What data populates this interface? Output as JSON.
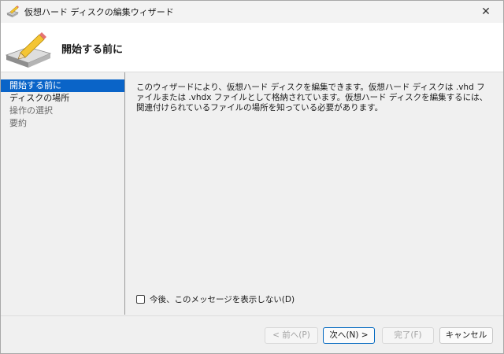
{
  "window": {
    "title": "仮想ハード ディスクの編集ウィザード",
    "close_glyph": "✕"
  },
  "header": {
    "title": "開始する前に"
  },
  "nav": {
    "items": [
      {
        "label": "開始する前に",
        "state": "active"
      },
      {
        "label": "ディスクの場所",
        "state": "normal"
      },
      {
        "label": "操作の選択",
        "state": "disabled"
      },
      {
        "label": "要約",
        "state": "disabled"
      }
    ]
  },
  "content": {
    "description": "このウィザードにより、仮想ハード ディスクを編集できます。仮想ハード ディスクは .vhd ファイルまたは .vhdx ファイルとして格納されています。仮想ハード ディスクを編集するには、関連付けられているファイルの場所を知っている必要があります。"
  },
  "options": {
    "dont_show_label": "今後、このメッセージを表示しない(D)",
    "dont_show_checked": false
  },
  "buttons": {
    "prev": "< 前へ(P)",
    "next": "次へ(N) >",
    "finish": "完了(F)",
    "cancel": "キャンセル"
  },
  "colors": {
    "accent": "#0a64c8",
    "primary_border": "#0067c0"
  },
  "icons": {
    "app": "disk-pencil-icon",
    "hero": "disk-pencil-icon",
    "close": "close-icon"
  }
}
